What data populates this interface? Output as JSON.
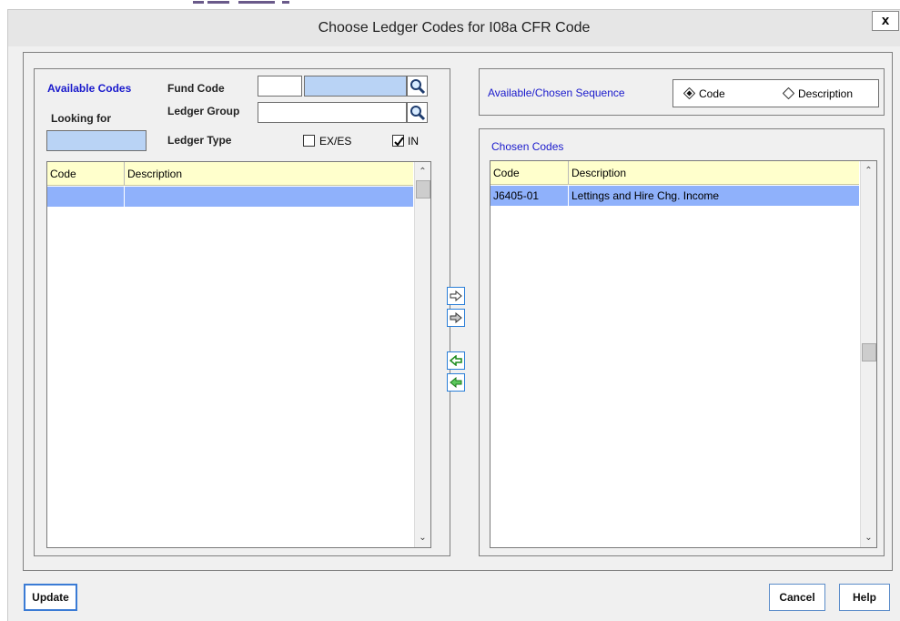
{
  "dialog": {
    "title": "Choose Ledger Codes for I08a CFR Code",
    "close_label": "x"
  },
  "filters": {
    "available_codes_label": "Available Codes",
    "looking_for_label": "Looking for",
    "fund_code_label": "Fund Code",
    "ledger_group_label": "Ledger Group",
    "ledger_type_label": "Ledger Type",
    "fund_code_value": "",
    "fund_code_desc_value": "",
    "ledger_group_value": "",
    "looking_for_value": "",
    "ex_es_label": "EX/ES",
    "ex_es_checked": false,
    "in_label": "IN",
    "in_checked": true
  },
  "available_grid": {
    "columns": [
      "Code",
      "Description"
    ],
    "rows": [
      {
        "code": "",
        "description": ""
      }
    ]
  },
  "sequence": {
    "label": "Available/Chosen Sequence",
    "options": [
      "Code",
      "Description"
    ],
    "selected": "Code"
  },
  "chosen": {
    "label": "Chosen Codes",
    "columns": [
      "Code",
      "Description"
    ],
    "rows": [
      {
        "code": "J6405-01",
        "description": "Lettings and Hire Chg. Income"
      }
    ]
  },
  "buttons": {
    "update": "Update",
    "cancel": "Cancel",
    "help": "Help"
  },
  "colors": {
    "selected_row": "#8fb1fb",
    "header_bg": "#ffffcc",
    "label_blue": "#1a1acc",
    "field_blue": "#b9d3f5"
  },
  "icons": {
    "search": "magnifier-icon",
    "move_right": "arrow-right-outline-icon",
    "move_all_right": "arrow-right-filled-icon",
    "move_left": "arrow-left-green-icon",
    "move_all_left": "arrow-left-green-filled-icon"
  }
}
